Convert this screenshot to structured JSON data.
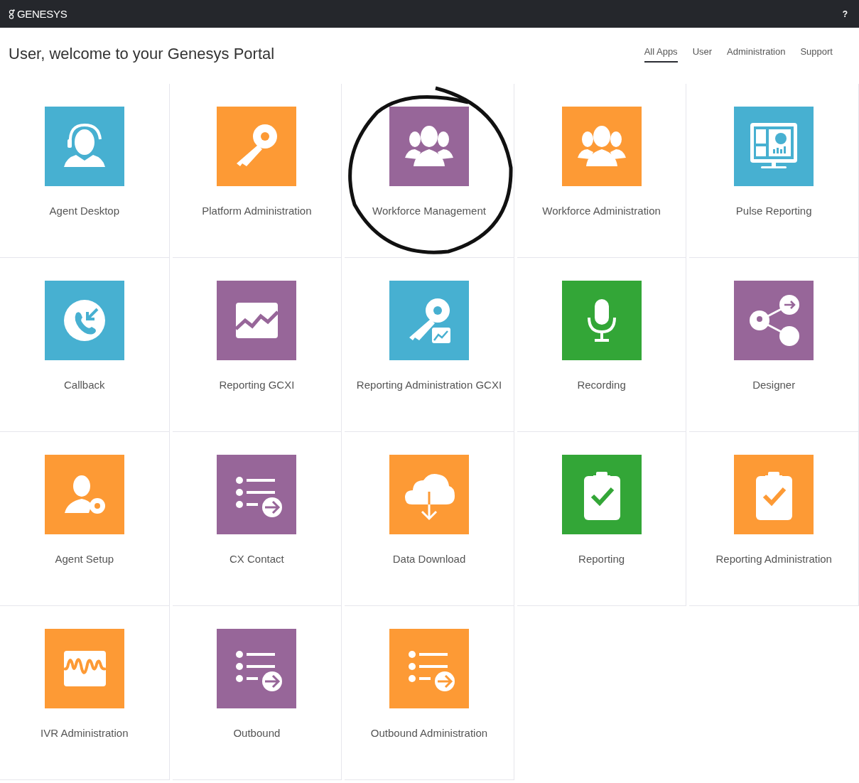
{
  "topbar": {
    "logo": "GENESYS",
    "help": "?"
  },
  "welcome": "User, welcome to your Genesys Portal",
  "tabs": [
    {
      "label": "All Apps",
      "selected": true
    },
    {
      "label": "User",
      "selected": false
    },
    {
      "label": "Administration",
      "selected": false
    },
    {
      "label": "Support",
      "selected": false
    }
  ],
  "apps": [
    {
      "label": "Agent Desktop",
      "kind": "headset",
      "color": "#47b0d1",
      "highlighted": false
    },
    {
      "label": "Platform Administration",
      "kind": "key",
      "color": "#fd9a35",
      "highlighted": false
    },
    {
      "label": "Workforce Management",
      "kind": "group",
      "color": "#976699",
      "highlighted": true
    },
    {
      "label": "Workforce Administration",
      "kind": "group",
      "color": "#fd9a35",
      "highlighted": false
    },
    {
      "label": "Pulse Reporting",
      "kind": "monitor",
      "color": "#47b0d1",
      "highlighted": false
    },
    {
      "label": "Callback",
      "kind": "callback",
      "color": "#47b0d1",
      "highlighted": false
    },
    {
      "label": "Reporting GCXI",
      "kind": "chart",
      "color": "#976699",
      "highlighted": false
    },
    {
      "label": "Reporting Administration GCXI",
      "kind": "keychart",
      "color": "#47b0d1",
      "highlighted": false
    },
    {
      "label": "Recording",
      "kind": "mic",
      "color": "#33a637",
      "highlighted": false
    },
    {
      "label": "Designer",
      "kind": "share",
      "color": "#976699",
      "highlighted": false
    },
    {
      "label": "Agent Setup",
      "kind": "agentgear",
      "color": "#fd9a35",
      "highlighted": false
    },
    {
      "label": "CX Contact",
      "kind": "list",
      "color": "#976699",
      "highlighted": false
    },
    {
      "label": "Data Download",
      "kind": "cloud",
      "color": "#fd9a35",
      "highlighted": false
    },
    {
      "label": "Reporting",
      "kind": "clipboard",
      "color": "#33a637",
      "highlighted": false
    },
    {
      "label": "Reporting Administration",
      "kind": "clipboard",
      "color": "#fd9a35",
      "highlighted": false
    },
    {
      "label": "IVR Administration",
      "kind": "wave",
      "color": "#fd9a35",
      "highlighted": false
    },
    {
      "label": "Outbound",
      "kind": "list",
      "color": "#976699",
      "highlighted": false
    },
    {
      "label": "Outbound Administration",
      "kind": "list",
      "color": "#fd9a35",
      "highlighted": false
    }
  ]
}
